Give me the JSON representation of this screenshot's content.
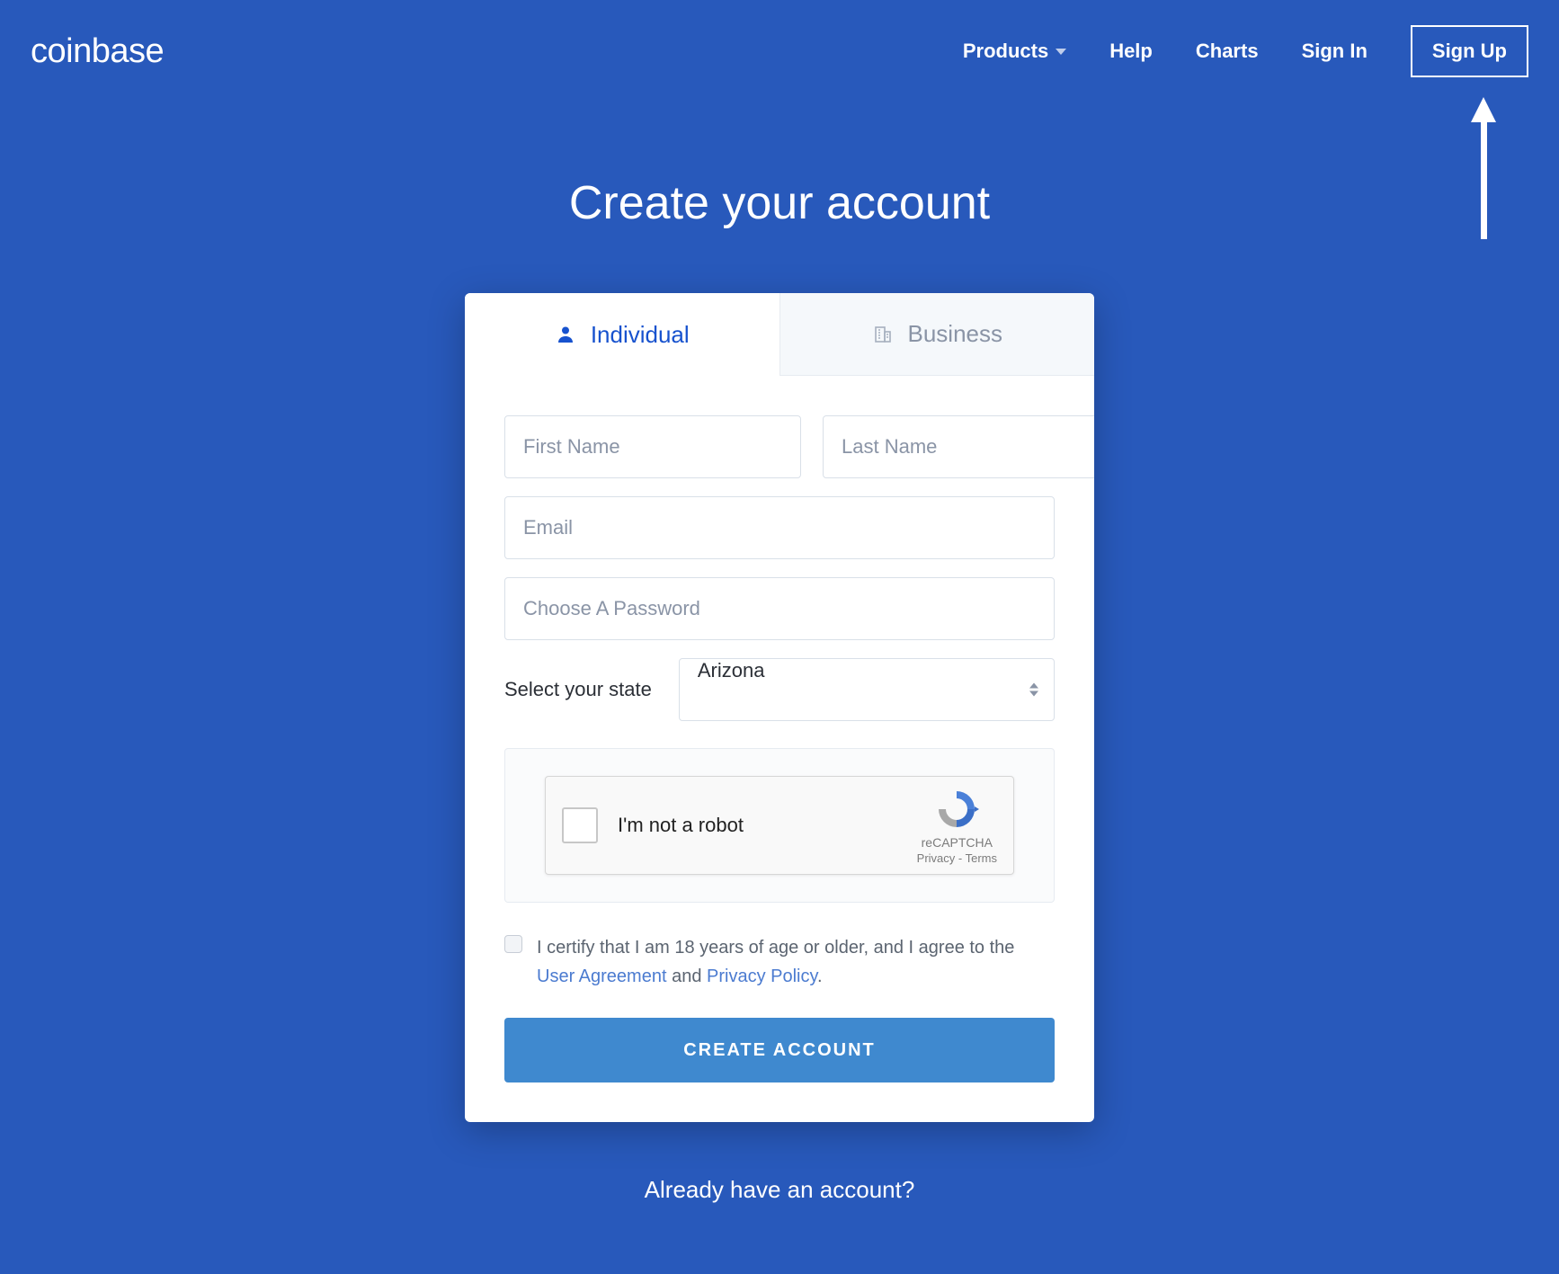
{
  "brand": "coinbase",
  "nav": {
    "products": "Products",
    "help": "Help",
    "charts": "Charts",
    "signin": "Sign In",
    "signup": "Sign Up"
  },
  "title": "Create your account",
  "tabs": {
    "individual": "Individual",
    "business": "Business"
  },
  "form": {
    "first_name_ph": "First Name",
    "last_name_ph": "Last Name",
    "email_ph": "Email",
    "password_ph": "Choose A Password",
    "state_label": "Select your state",
    "state_value": "Arizona"
  },
  "captcha": {
    "text": "I'm not a robot",
    "brand": "reCAPTCHA",
    "privacy": "Privacy",
    "terms": "Terms"
  },
  "consent": {
    "prefix": "I certify that I am 18 years of age or older, and I agree to the ",
    "ua": "User Agreement",
    "and": " and ",
    "pp": "Privacy Policy",
    "suffix": "."
  },
  "submit": "CREATE ACCOUNT",
  "already": "Already have an account?"
}
